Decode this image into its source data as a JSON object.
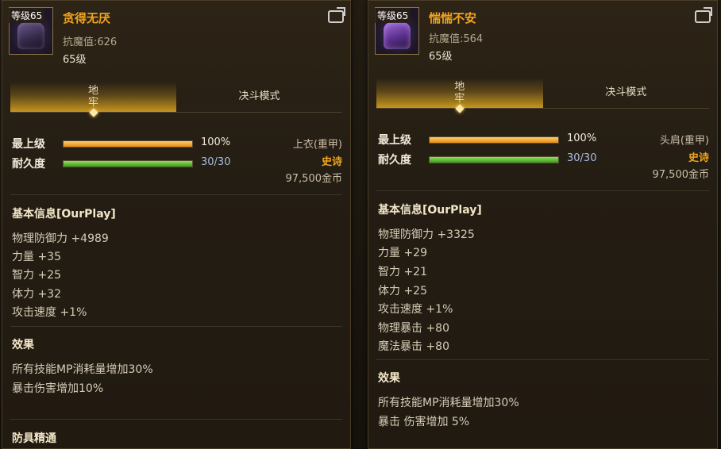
{
  "left": {
    "level_tag": "等级65",
    "name": "贪得无厌",
    "resist": "抗魔值:626",
    "level": "65级",
    "tabs": [
      "地牢",
      "决斗模式"
    ],
    "max_level_label": "最上级",
    "max_level_value": "100%",
    "durability_label": "耐久度",
    "durability_value": "30/30",
    "slot": "上衣(重甲)",
    "rarity": "史诗",
    "price": "97,500金币",
    "basic_title": "基本信息[OurPlay]",
    "stats": [
      "物理防御力 +4989",
      "力量 +35",
      "智力 +25",
      "体力 +32",
      "攻击速度 +1%"
    ],
    "effect_title": "效果",
    "effects": [
      "所有技能MP消耗量增加30%",
      "暴击伤害增加10%"
    ],
    "mastery_title": "防具精通"
  },
  "right": {
    "level_tag": "等级65",
    "name": "惴惴不安",
    "resist": "抗魔值:564",
    "level": "65级",
    "tabs": [
      "地牢",
      "决斗模式"
    ],
    "max_level_label": "最上级",
    "max_level_value": "100%",
    "durability_label": "耐久度",
    "durability_value": "30/30",
    "slot": "头肩(重甲)",
    "rarity": "史诗",
    "price": "97,500金币",
    "basic_title": "基本信息[OurPlay]",
    "stats": [
      "物理防御力 +3325",
      "力量 +29",
      "智力 +21",
      "体力 +25",
      "攻击速度 +1%",
      "物理暴击 +80",
      "魔法暴击 +80"
    ],
    "effect_title": "效果",
    "effects": [
      "所有技能MP消耗量增加30%",
      "暴击 伤害增加 5%"
    ]
  },
  "bars": {
    "max_level_fill": 1.0,
    "durability_fill": 1.0
  },
  "colors": {
    "name": "#f2a41c",
    "rarity": "#f2a41c",
    "durability_text": "#a9bde0"
  }
}
